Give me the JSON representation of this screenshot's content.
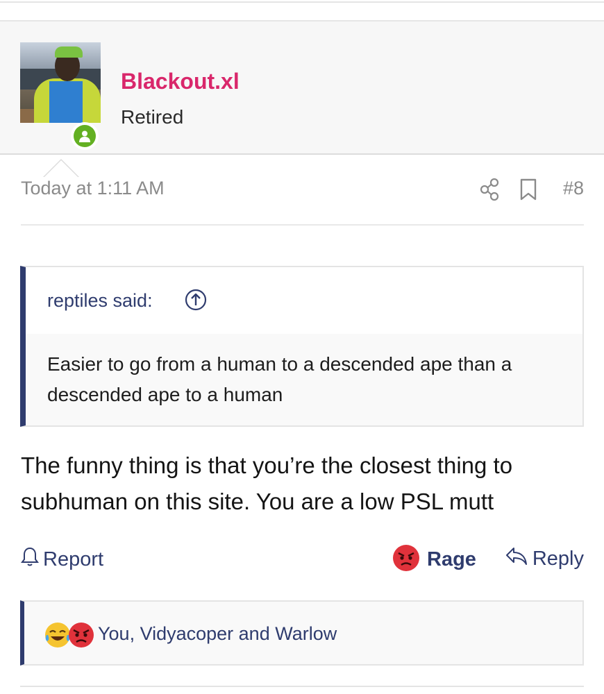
{
  "user": {
    "name": "Blackout.xl",
    "title": "Retired",
    "online": true
  },
  "post": {
    "timestamp": "Today at 1:11 AM",
    "number": "#8",
    "quote": {
      "author": "reptiles said:",
      "text": "Easier to go from a human to a descended ape than a descended ape to a human"
    },
    "message": "The funny thing is that you’re the closest thing to subhuman on this site. You are a low PSL mutt"
  },
  "actions": {
    "report_label": "Report",
    "reaction_label": "Rage",
    "reply_label": "Reply"
  },
  "reactions": {
    "users_text": "You, Vidyacoper and Warlow",
    "icons": [
      "laughing-crying-emoji-icon",
      "angry-emoji-icon"
    ]
  },
  "colors": {
    "username": "#d9276b",
    "accent": "#2f3c6e",
    "online": "#63b022",
    "muted": "#8a8a8a"
  }
}
